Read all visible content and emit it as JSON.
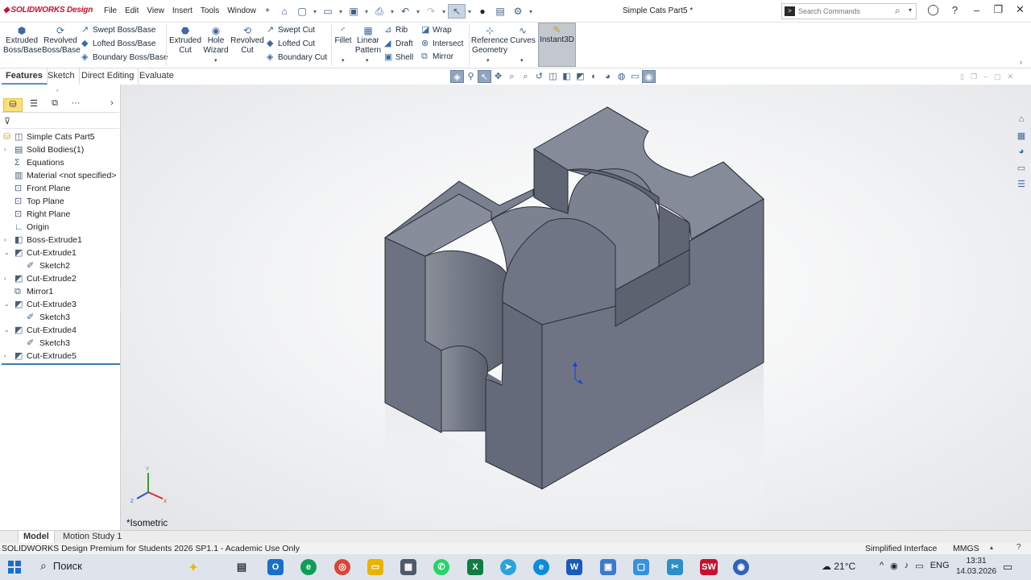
{
  "app": {
    "logo_text": "SOLIDWORKS Design",
    "document_title": "Simple Cats Part5 *",
    "menu": [
      "File",
      "Edit",
      "View",
      "Insert",
      "Tools",
      "Window"
    ],
    "search_placeholder": "Search Commands",
    "accent_color": "#c8102e"
  },
  "ribbon": {
    "large_buttons": {
      "extruded_boss": "Extruded\nBoss/Base",
      "revolved_boss": "Revolved\nBoss/Base",
      "extruded_cut": "Extruded\nCut",
      "hole_wizard": "Hole\nWizard",
      "revolved_cut": "Revolved\nCut",
      "fillet": "Fillet",
      "linear_pattern": "Linear\nPattern",
      "reference_geometry": "Reference\nGeometry",
      "curves": "Curves",
      "instant3d": "Instant3D"
    },
    "small_buttons": {
      "swept_boss": "Swept Boss/Base",
      "lofted_boss": "Lofted Boss/Base",
      "boundary_boss": "Boundary Boss/Base",
      "swept_cut": "Swept Cut",
      "lofted_cut": "Lofted Cut",
      "boundary_cut": "Boundary Cut",
      "rib": "Rib",
      "draft": "Draft",
      "shell": "Shell",
      "wrap": "Wrap",
      "intersect": "Intersect",
      "mirror": "Mirror"
    }
  },
  "tabs": [
    "Features",
    "Sketch",
    "Direct Editing",
    "Evaluate"
  ],
  "feature_tree": {
    "root": "Simple Cats Part5",
    "items": [
      {
        "label": "Solid Bodies(1)",
        "icon": "folder-icon"
      },
      {
        "label": "Equations",
        "icon": "equation-icon"
      },
      {
        "label": "Material <not specified>",
        "icon": "material-icon"
      },
      {
        "label": "Front Plane",
        "icon": "plane-icon"
      },
      {
        "label": "Top Plane",
        "icon": "plane-icon"
      },
      {
        "label": "Right Plane",
        "icon": "plane-icon"
      },
      {
        "label": "Origin",
        "icon": "origin-icon"
      },
      {
        "label": "Boss-Extrude1",
        "icon": "extrude-icon"
      },
      {
        "label": "Cut-Extrude1",
        "icon": "cut-icon"
      },
      {
        "label": "Sketch2",
        "icon": "sketch-icon"
      },
      {
        "label": "Cut-Extrude2",
        "icon": "cut-icon"
      },
      {
        "label": "Mirror1",
        "icon": "mirror-icon"
      },
      {
        "label": "Cut-Extrude3",
        "icon": "cut-icon"
      },
      {
        "label": "Sketch3",
        "icon": "sketch-icon"
      },
      {
        "label": "Cut-Extrude4",
        "icon": "cut-icon"
      },
      {
        "label": "Sketch3",
        "icon": "sketch-icon"
      },
      {
        "label": "Cut-Extrude5",
        "icon": "cut-icon"
      }
    ]
  },
  "viewport": {
    "view_label": "*Isometric",
    "part_color": "#7d8494"
  },
  "bottom_tabs": [
    "Model",
    "Motion Study 1"
  ],
  "status": {
    "text": "SOLIDWORKS Design Premium for Students 2026 SP1.1 - Academic Use Only",
    "interface": "Simplified Interface",
    "units": "MMGS"
  },
  "taskbar": {
    "search": "Поиск",
    "weather": "21°C",
    "language": "ENG",
    "time": "13:31",
    "date": "14.03.2026"
  }
}
